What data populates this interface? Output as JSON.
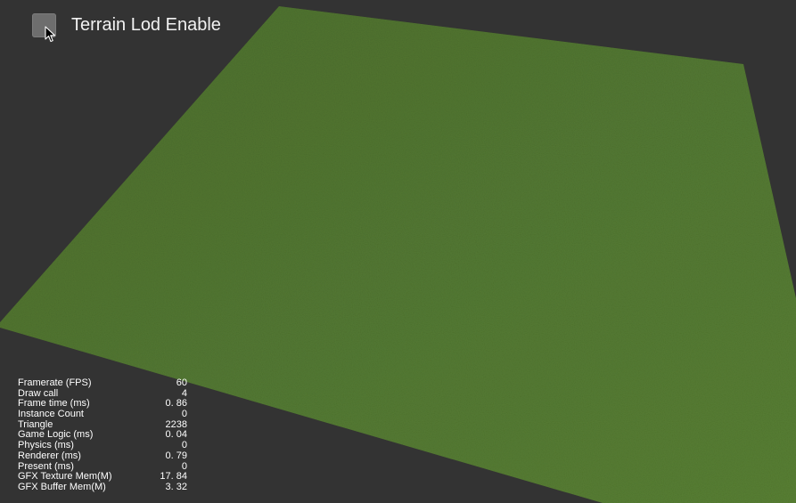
{
  "scene": {
    "background_color": "#333333",
    "terrain_color": "#527733"
  },
  "ui": {
    "lod_toggle": {
      "label": "Terrain Lod Enable",
      "checked": false
    }
  },
  "stats": [
    {
      "label": "Framerate (FPS)",
      "value": "60"
    },
    {
      "label": "Draw call",
      "value": "4"
    },
    {
      "label": "Frame time (ms)",
      "value": "0. 86"
    },
    {
      "label": "Instance Count",
      "value": "0"
    },
    {
      "label": "Triangle",
      "value": "2238"
    },
    {
      "label": "Game Logic (ms)",
      "value": "0. 04"
    },
    {
      "label": "Physics (ms)",
      "value": "0"
    },
    {
      "label": "Renderer (ms)",
      "value": "0. 79"
    },
    {
      "label": "Present (ms)",
      "value": "0"
    },
    {
      "label": "GFX Texture Mem(M)",
      "value": "17. 84"
    },
    {
      "label": "GFX Buffer Mem(M)",
      "value": "3. 32"
    }
  ]
}
